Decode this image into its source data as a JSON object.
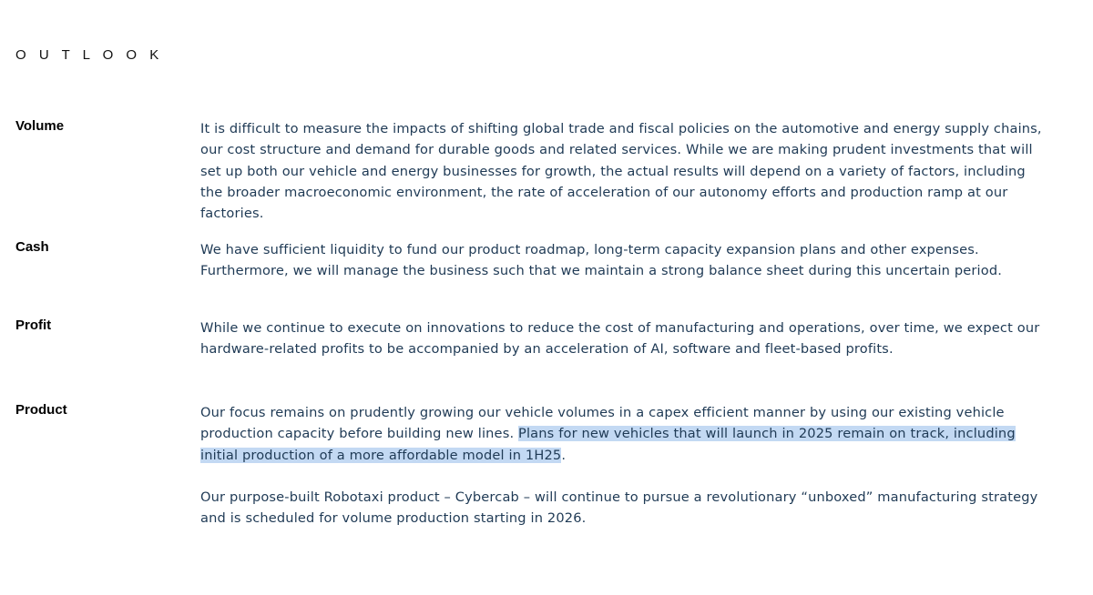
{
  "heading": "O U T L O O K",
  "sections": {
    "volume": {
      "label": "Volume",
      "text": "It is difficult to measure the impacts of shifting global trade and fiscal policies on the automotive and energy supply chains, our cost structure and demand for durable goods and related services. While we are making prudent investments that will set up both our vehicle and energy businesses for growth, the actual results will depend on a variety of factors, including the broader macroeconomic environment, the rate of acceleration of our autonomy efforts and production ramp at our factories."
    },
    "cash": {
      "label": "Cash",
      "text": "We have sufficient liquidity to fund our product roadmap, long-term capacity expansion plans and other expenses. Furthermore, we will manage the business such that we maintain a strong balance sheet during this uncertain period."
    },
    "profit": {
      "label": "Profit",
      "text": "While we continue to execute on innovations to reduce the cost of manufacturing and operations, over time, we expect our hardware-related profits to be accompanied by an acceleration of AI, software and fleet-based profits."
    },
    "product": {
      "label": "Product",
      "text_plain": "Our focus remains on prudently growing our vehicle volumes in a capex efficient manner by using our existing vehicle production capacity before building new lines. ",
      "text_highlighted": "Plans for new vehicles that will launch in 2025 remain on track, including initial production of a more affordable model in 1H25",
      "text_end": ".",
      "text2": "Our purpose-built Robotaxi product – Cybercab – will continue to pursue a revolutionary “unboxed” manufacturing strategy and is scheduled for volume production starting in 2026."
    }
  },
  "colors": {
    "body_text": "#1f3a55",
    "label_text": "#000000",
    "highlight": "#c3d9f3"
  }
}
